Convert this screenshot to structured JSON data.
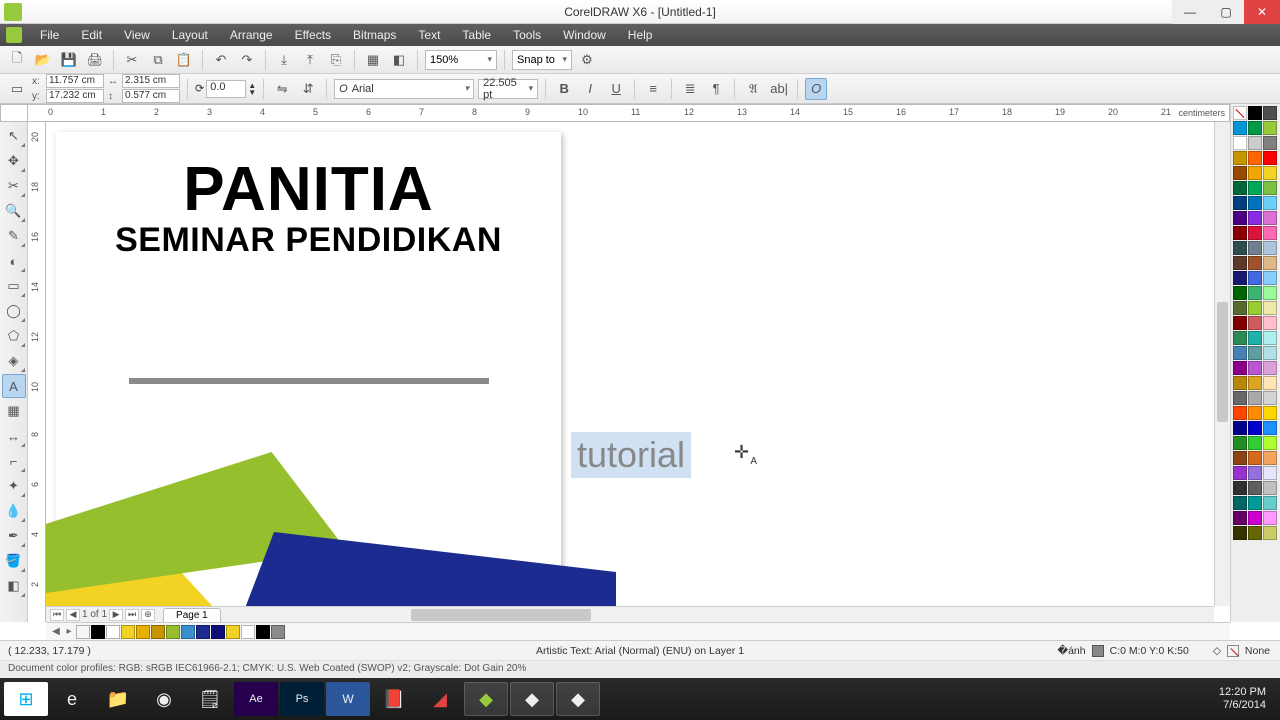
{
  "titlebar": {
    "title": "CorelDRAW X6 - [Untitled-1]"
  },
  "menu": [
    "File",
    "Edit",
    "View",
    "Layout",
    "Arrange",
    "Effects",
    "Bitmaps",
    "Text",
    "Table",
    "Tools",
    "Window",
    "Help"
  ],
  "toolbar1": {
    "zoom": "150%",
    "snap": "Snap to"
  },
  "propbar": {
    "x": "11.757 cm",
    "y": "17.232 cm",
    "w": "2.315 cm",
    "h": "0.577 cm",
    "rot": "0.0",
    "font": "Arial",
    "size": "22.505 pt"
  },
  "ruler_unit": "centimeters",
  "ruler_h": [
    0,
    1,
    2,
    3,
    4,
    5,
    6,
    7,
    8,
    9,
    10,
    11,
    12,
    13,
    14,
    15,
    16,
    17,
    18,
    19,
    20,
    21
  ],
  "ruler_v": [
    20,
    18,
    16,
    14,
    12,
    10,
    8,
    6,
    4,
    2
  ],
  "canvas": {
    "h1": "PANITIA",
    "h2": "SEMINAR PENDIDIKAN",
    "sel_text": "tutorial"
  },
  "page_nav": {
    "label": "1 of 1",
    "tab": "Page 1"
  },
  "doc_palette": [
    "#ffffff00",
    "#000000",
    "#ffffff",
    "#f2d323",
    "#e8b000",
    "#c79500",
    "#96bf2d",
    "#3a8fd0",
    "#1b2b8f",
    "#0f0f7a",
    "#f2d323",
    "#ffffff",
    "#000000",
    "#8a8a8a"
  ],
  "palette": [
    "#ffffff00",
    "#000000",
    "#4d4d4d",
    "#0096d6",
    "#009944",
    "#97c93d",
    "#ffffff",
    "#cccccc",
    "#808080",
    "#c79500",
    "#ff6600",
    "#ff0000",
    "#964b00",
    "#f2a700",
    "#f2d323",
    "#006838",
    "#00a859",
    "#7ac143",
    "#003f7f",
    "#0072bc",
    "#6dcff6",
    "#4b0082",
    "#8a2be2",
    "#da70d6",
    "#8b0000",
    "#dc143c",
    "#ff69b4",
    "#2f4f4f",
    "#708090",
    "#b0c4de",
    "#5b3a29",
    "#a0522d",
    "#deb887",
    "#191970",
    "#4169e1",
    "#87cefa",
    "#006400",
    "#3cb371",
    "#98fb98",
    "#556b2f",
    "#9acd32",
    "#eee8aa",
    "#800000",
    "#cd5c5c",
    "#ffc0cb",
    "#2e8b57",
    "#20b2aa",
    "#afeeee",
    "#4682b4",
    "#5f9ea0",
    "#b0e0e6",
    "#8b008b",
    "#ba55d3",
    "#dda0dd",
    "#b8860b",
    "#daa520",
    "#ffe4b5",
    "#696969",
    "#a9a9a9",
    "#d3d3d3",
    "#ff4500",
    "#ff8c00",
    "#ffd700",
    "#00008b",
    "#0000cd",
    "#1e90ff",
    "#228b22",
    "#32cd32",
    "#adff2f",
    "#8b4513",
    "#d2691e",
    "#f4a460",
    "#9932cc",
    "#9370db",
    "#e6e6fa",
    "#2f2f2f",
    "#5f5f5f",
    "#bfbfbf",
    "#006666",
    "#009999",
    "#66cccc",
    "#660066",
    "#cc00cc",
    "#ff99ff",
    "#333300",
    "#666600",
    "#cccc66"
  ],
  "status": {
    "coords": "( 12.233, 17.179 )",
    "mid": "Artistic Text: Arial (Normal) (ENU) on Layer 1",
    "fill_label": "C:0 M:0 Y:0 K:50",
    "outline_label": "None",
    "profiles": "Document color profiles: RGB: sRGB IEC61966-2.1; CMYK: U.S. Web Coated (SWOP) v2; Grayscale: Dot Gain 20%"
  },
  "taskbar": {
    "time": "12:20 PM",
    "date": "7/6/2014"
  }
}
